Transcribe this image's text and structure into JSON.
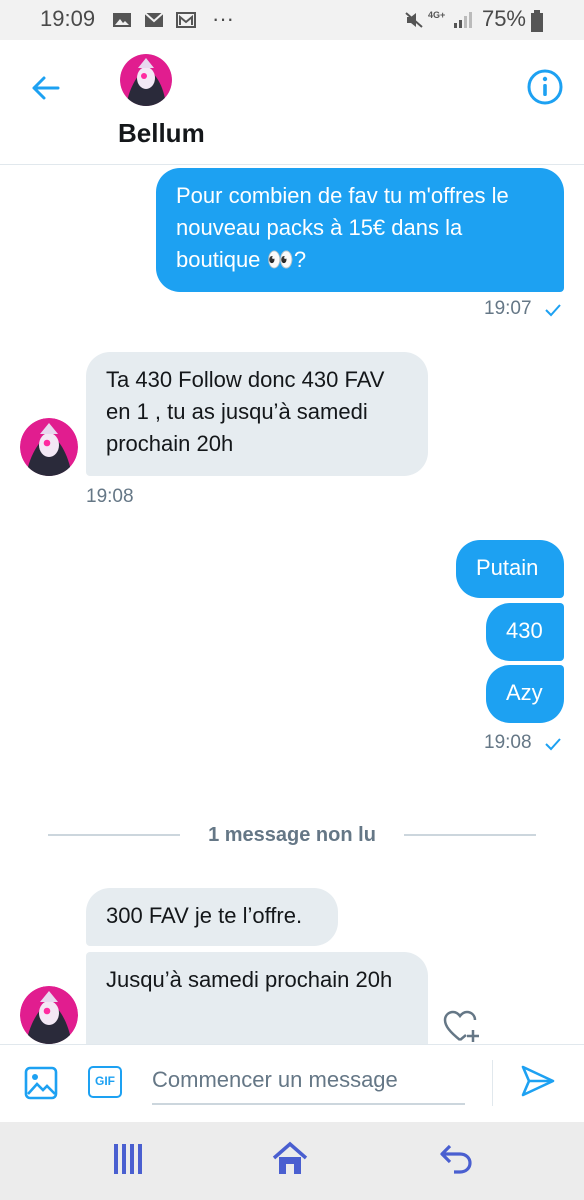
{
  "status_bar": {
    "time": "19:09",
    "network": "4G+",
    "battery": "75%"
  },
  "header": {
    "contact_name": "Bellum"
  },
  "messages": [
    {
      "direction": "out",
      "text": "Pour combien de fav tu m'offres le nouveau packs à 15€ dans la boutique 👀?"
    },
    {
      "direction": "out",
      "timestamp": "19:07"
    },
    {
      "direction": "in",
      "text": "Ta 430 Follow donc 430 FAV en 1 , tu as jusqu’à samedi prochain 20h"
    },
    {
      "direction": "in",
      "timestamp": "19:08"
    },
    {
      "direction": "out",
      "text": "Putain"
    },
    {
      "direction": "out",
      "text": "430"
    },
    {
      "direction": "out",
      "text": "Azy"
    },
    {
      "direction": "out",
      "timestamp": "19:08"
    },
    {
      "direction": "in",
      "text": "300 FAV je te l’offre."
    },
    {
      "direction": "in",
      "text": "Jusqu’à samedi prochain 20h"
    }
  ],
  "unread_divider": "1 message non lu",
  "composer": {
    "placeholder": "Commencer un message",
    "gif_label": "GIF"
  },
  "colors": {
    "accent": "#1da1f2",
    "incoming_bubble": "#e6ecf0",
    "timestamp": "#657786"
  },
  "icons": [
    "back-arrow-icon",
    "info-icon",
    "image-icon",
    "gif-icon",
    "send-icon",
    "heart-add-icon",
    "recent-apps-icon",
    "home-icon",
    "back-nav-icon"
  ]
}
